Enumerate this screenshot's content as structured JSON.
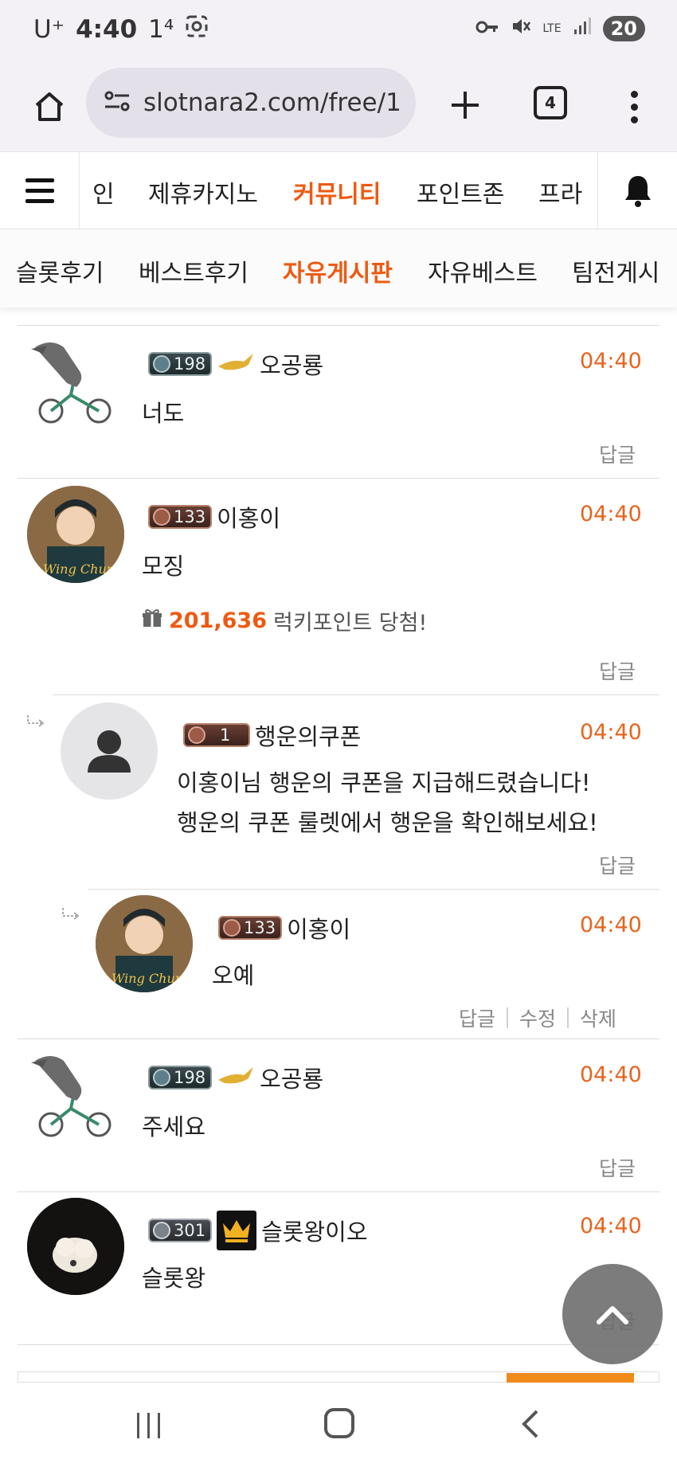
{
  "status_bar": {
    "carrier": "U⁺",
    "time": "4:40",
    "extra": "1⁴",
    "network": "LTE",
    "battery": "20"
  },
  "browser": {
    "url": "slotnara2.com/free/1",
    "tab_count": "4"
  },
  "site_nav": {
    "items": [
      "인",
      "제휴카지노",
      "커뮤니티",
      "포인트존",
      "프라"
    ],
    "active": "커뮤니티"
  },
  "sub_nav": {
    "items": [
      "슬롯후기",
      "베스트후기",
      "자유게시판",
      "자유베스트",
      "팀전게시"
    ],
    "active": "자유게시판"
  },
  "comments": [
    {
      "nick": "오공룡",
      "level": "198",
      "time": "04:40",
      "text": "너도",
      "reply_label": "답글"
    },
    {
      "nick": "이홍이",
      "level": "133",
      "time": "04:40",
      "text": "모징",
      "lucky_amount": "201,636",
      "lucky_text": "럭키포인트 당첨!",
      "reply_label": "답글"
    },
    {
      "nick": "행운의쿠폰",
      "level": "1",
      "time": "04:40",
      "text_line1": "이홍이님 행운의 쿠폰을 지급해드렸습니다!",
      "text_line2": "행운의 쿠폰 룰렛에서 행운을 확인해보세요!",
      "reply_label": "답글"
    },
    {
      "nick": "이홍이",
      "level": "133",
      "time": "04:40",
      "text": "오예",
      "reply_label": "답글",
      "edit_label": "수정",
      "delete_label": "삭제"
    },
    {
      "nick": "오공룡",
      "level": "198",
      "time": "04:40",
      "text": "주세요",
      "reply_label": "답글"
    },
    {
      "nick": "슬롯왕이오",
      "level": "301",
      "time": "04:40",
      "text": "슬롯왕",
      "reply_label": "답글"
    }
  ],
  "colors": {
    "accent": "#ee5a12",
    "time": "#e8641e",
    "muted": "#888888"
  }
}
